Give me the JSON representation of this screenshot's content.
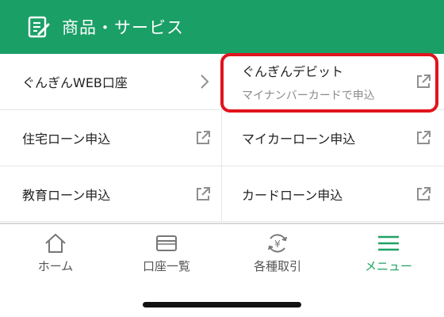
{
  "colors": {
    "brand": "#1a9f66",
    "highlight": "#e0141d",
    "active_tab": "#1fa265"
  },
  "header": {
    "title": "商品・サービス",
    "icon": "document-edit-icon"
  },
  "menu": {
    "items": [
      {
        "label": "ぐんぎんWEB口座",
        "icon": "chevron-right-icon"
      },
      {
        "label": "ぐんぎんデビット",
        "sublabel": "マイナンバーカードで申込",
        "icon": "external-link-icon",
        "highlighted": true
      },
      {
        "label": "住宅ローン申込",
        "icon": "external-link-icon"
      },
      {
        "label": "マイカーローン申込",
        "icon": "external-link-icon"
      },
      {
        "label": "教育ローン申込",
        "icon": "external-link-icon"
      },
      {
        "label": "カードローン申込",
        "icon": "external-link-icon"
      }
    ]
  },
  "tabbar": {
    "tabs": [
      {
        "label": "ホーム",
        "icon": "home-icon"
      },
      {
        "label": "口座一覧",
        "icon": "card-icon"
      },
      {
        "label": "各種取引",
        "icon": "yen-exchange-icon"
      },
      {
        "label": "メニュー",
        "icon": "menu-icon",
        "active": true
      }
    ]
  }
}
